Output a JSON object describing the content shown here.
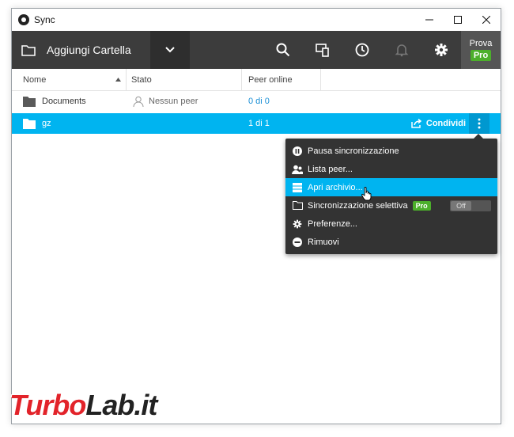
{
  "window": {
    "title": "Sync"
  },
  "toolbar": {
    "add_folder_label": "Aggiungi Cartella",
    "trial_label": "Prova",
    "trial_badge": "Pro"
  },
  "table": {
    "columns": [
      "Nome",
      "Stato",
      "Peer online"
    ],
    "rows": [
      {
        "name": "Documents",
        "status": "Nessun peer",
        "peers": "0 di 0"
      },
      {
        "name": "gz",
        "status": "",
        "peers": "1 di 1",
        "share_label": "Condividi"
      }
    ]
  },
  "menu": {
    "items": [
      {
        "label": "Pausa sincronizzazione",
        "icon": "pause-icon"
      },
      {
        "label": "Lista peer...",
        "icon": "users-icon"
      },
      {
        "label": "Apri archivio...",
        "icon": "archive-icon"
      },
      {
        "label": "Sincronizzazione selettiva",
        "icon": "folder-icon",
        "badge": "Pro",
        "toggle": "Off"
      },
      {
        "label": "Preferenze...",
        "icon": "gear-icon"
      },
      {
        "label": "Rimuovi",
        "icon": "remove-icon"
      }
    ]
  },
  "watermark": {
    "part1": "Turbo",
    "part2": "Lab.it"
  },
  "colors": {
    "accent": "#00b4f0",
    "toolbar": "#3c3c3c",
    "pro": "#4caf2b"
  }
}
